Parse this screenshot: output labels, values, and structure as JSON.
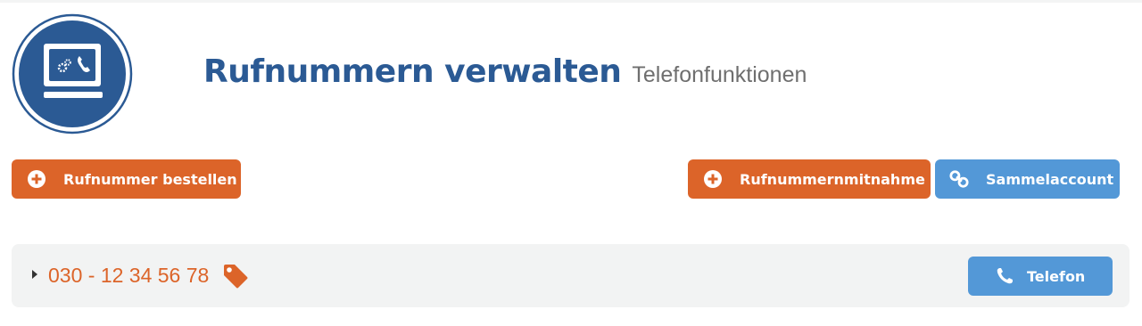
{
  "header": {
    "title": "Rufnummern verwalten",
    "subtitle": "Telefonfunktionen",
    "logo_icon": "computer-phone-icon"
  },
  "actions": {
    "order_label": "Rufnummer bestellen",
    "port_label": "Rufnummernmitnahme",
    "collect_label": "Sammelaccount"
  },
  "numbers": [
    {
      "number": "030 - 12 34 56 78",
      "phone_label": "Telefon"
    }
  ],
  "colors": {
    "primary_blue": "#2b5a94",
    "accent_orange": "#dc6429",
    "button_blue": "#5398d7",
    "row_bg": "#f2f3f3"
  }
}
